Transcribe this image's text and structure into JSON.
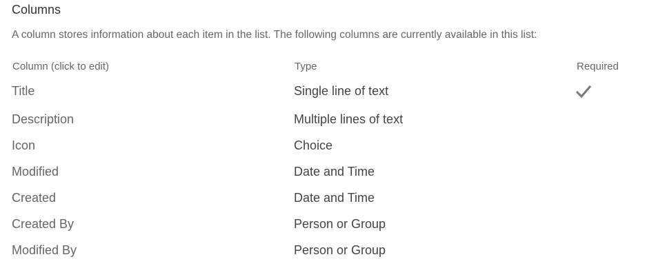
{
  "section": {
    "title": "Columns",
    "description": "A column stores information about each item in the list. The following columns are currently available in this list:"
  },
  "headers": {
    "column": "Column (click to edit)",
    "type": "Type",
    "required": "Required"
  },
  "icons": {
    "required": "checkmark-icon"
  },
  "colors": {
    "checkmark": "#777777"
  },
  "rows": [
    {
      "name": "Title",
      "type": "Single line of text",
      "required": true
    },
    {
      "name": "Description",
      "type": "Multiple lines of text",
      "required": false
    },
    {
      "name": "Icon",
      "type": "Choice",
      "required": false
    },
    {
      "name": "Modified",
      "type": "Date and Time",
      "required": false
    },
    {
      "name": "Created",
      "type": "Date and Time",
      "required": false
    },
    {
      "name": "Created By",
      "type": "Person or Group",
      "required": false
    },
    {
      "name": "Modified By",
      "type": "Person or Group",
      "required": false
    }
  ]
}
